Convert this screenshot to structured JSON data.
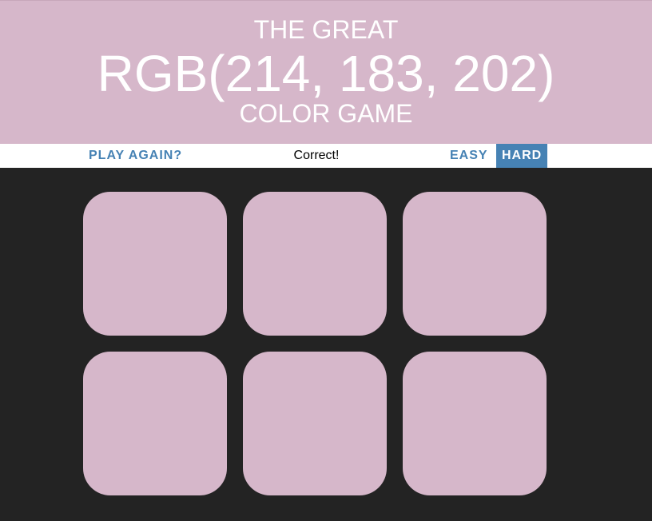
{
  "header": {
    "title_top": "THE GREAT",
    "rgb_display": "RGB(214, 183, 202)",
    "title_bottom": "COLOR GAME",
    "background_color": "#d6b7ca"
  },
  "stripe": {
    "reset_label": "PLAY AGAIN?",
    "message": "Correct!",
    "easy_label": "EASY",
    "hard_label": "HARD",
    "selected_mode": "HARD",
    "accent_color": "#4682b4"
  },
  "squares": [
    {
      "color": "#d6b7ca"
    },
    {
      "color": "#d6b7ca"
    },
    {
      "color": "#d6b7ca"
    },
    {
      "color": "#d6b7ca"
    },
    {
      "color": "#d6b7ca"
    },
    {
      "color": "#d6b7ca"
    }
  ],
  "page_background": "#232323"
}
